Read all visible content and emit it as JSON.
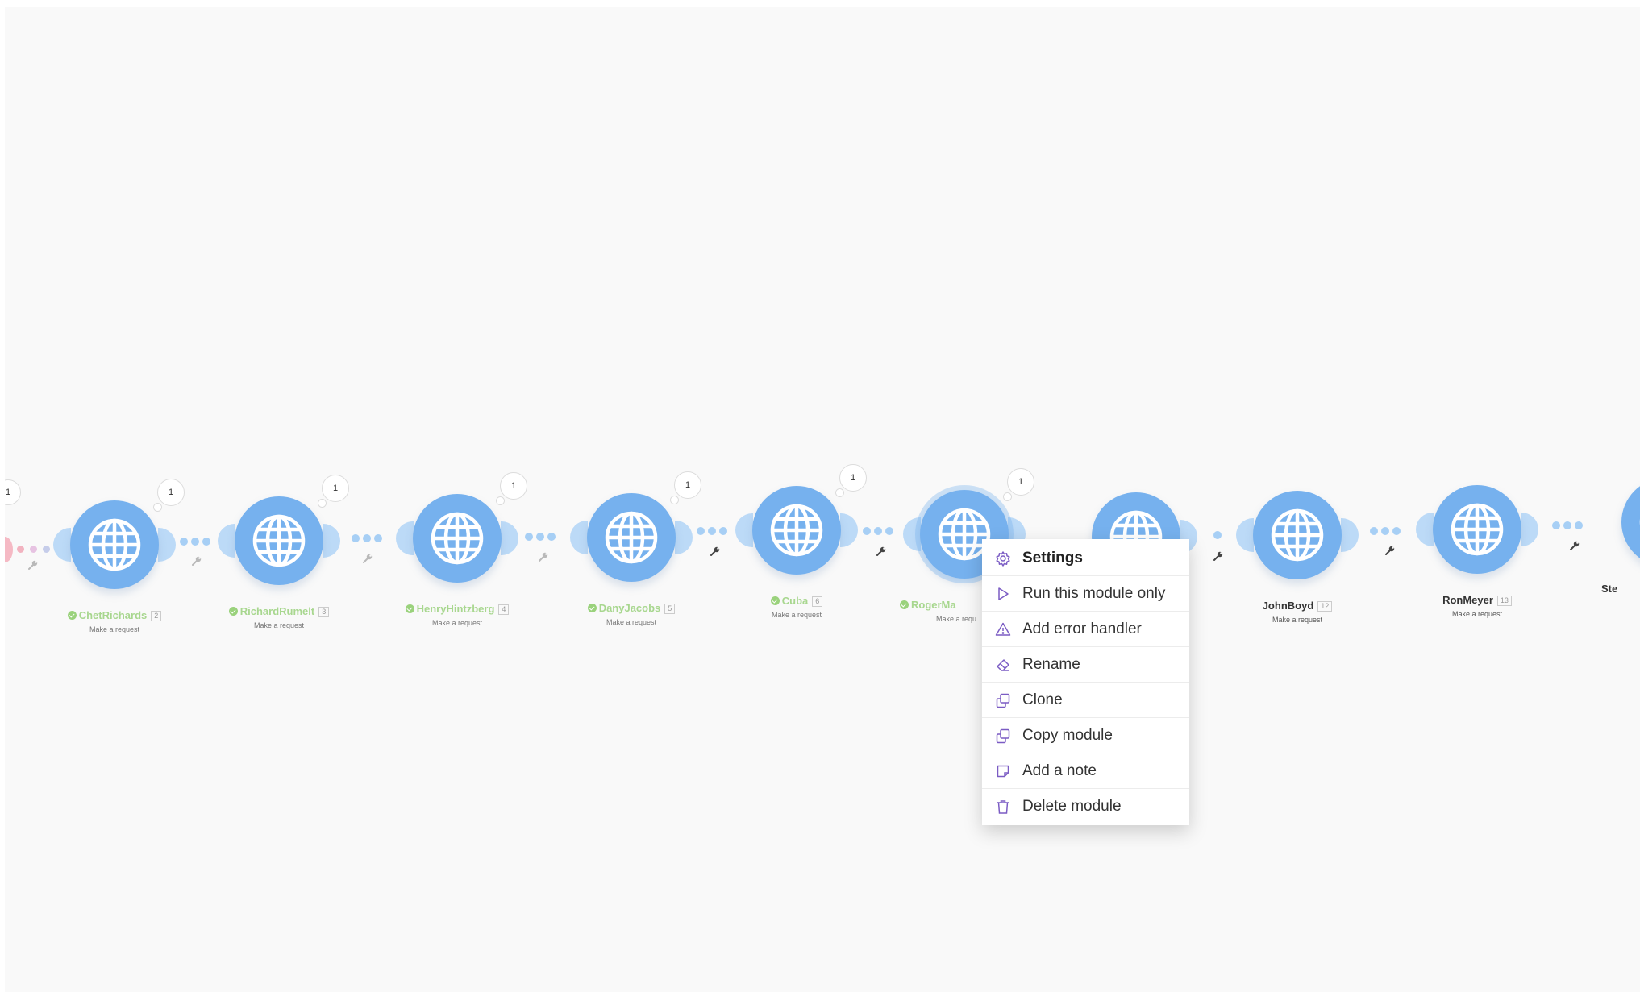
{
  "modules": [
    {
      "name": "ChetRichards",
      "num": "2",
      "sub": "Make a request",
      "bubble": "1",
      "ok": true
    },
    {
      "name": "RichardRumelt",
      "num": "3",
      "sub": "Make a request",
      "bubble": "1",
      "ok": true
    },
    {
      "name": "HenryHintzberg",
      "num": "4",
      "sub": "Make a request",
      "bubble": "1",
      "ok": true
    },
    {
      "name": "DanyJacobs",
      "num": "5",
      "sub": "Make a request",
      "bubble": "1",
      "ok": true
    },
    {
      "name": "Cuba",
      "num": "6",
      "sub": "Make a request",
      "bubble": "1",
      "ok": true
    },
    {
      "name": "RogerMa",
      "sub": "Make a requ",
      "bubble": "1",
      "ok": true
    },
    {
      "name": "JohnBoyd",
      "num": "12",
      "sub": "Make a request",
      "ok": false
    },
    {
      "name": "RonMeyer",
      "num": "13",
      "sub": "Make a request",
      "ok": false
    },
    {
      "name": "Ste"
    }
  ],
  "left_bubble": "1",
  "context_menu": {
    "items": [
      {
        "label": "Settings",
        "icon": "gear-icon"
      },
      {
        "label": "Run this module only",
        "icon": "play-icon"
      },
      {
        "label": "Add error handler",
        "icon": "warning-icon"
      },
      {
        "label": "Rename",
        "icon": "eraser-icon"
      },
      {
        "label": "Clone",
        "icon": "clone-icon"
      },
      {
        "label": "Copy module",
        "icon": "copy-icon"
      },
      {
        "label": "Add a note",
        "icon": "note-icon"
      },
      {
        "label": "Delete module",
        "icon": "trash-icon"
      }
    ]
  },
  "colors": {
    "module": "#76b1ee",
    "connector": "#a7cff5",
    "success": "#9ad27c",
    "menu_icon": "#7b5cc4"
  }
}
